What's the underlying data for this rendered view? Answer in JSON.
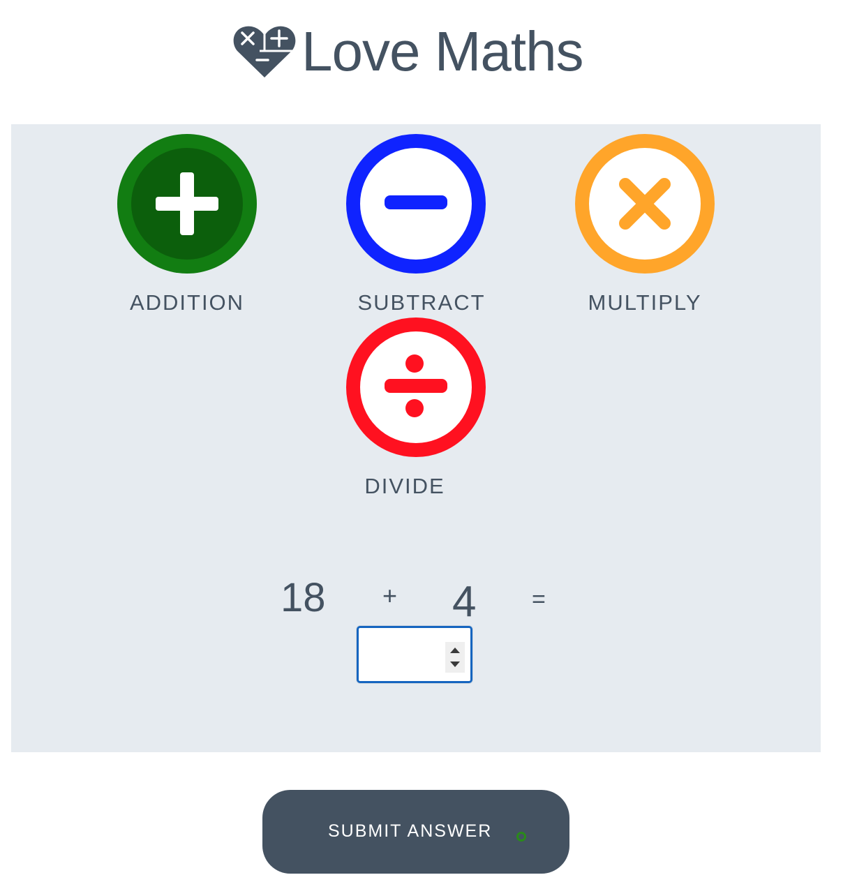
{
  "header": {
    "title": "Love Maths",
    "logo_icon": "heart-maths-icon"
  },
  "operations": [
    {
      "label": "ADDITION",
      "icon": "plus-icon",
      "color": "#127d12",
      "inner_color": "#0c5f0c"
    },
    {
      "label": "SUBTRACT",
      "icon": "minus-icon",
      "color": "#0f23ff"
    },
    {
      "label": "MULTIPLY",
      "icon": "times-icon",
      "color": "#ffa52a"
    },
    {
      "label": "DIVIDE",
      "icon": "divide-icon",
      "color": "#ff1120"
    }
  ],
  "question": {
    "operand1": "18",
    "operator": "+",
    "operand2": "4",
    "equals": "=",
    "answer_value": ""
  },
  "submit": {
    "label": "SUBMIT ANSWER"
  },
  "colors": {
    "text": "#445261",
    "game_area_bg": "#e6ebf0",
    "submit_bg": "#445261",
    "input_border": "#1565c0"
  }
}
